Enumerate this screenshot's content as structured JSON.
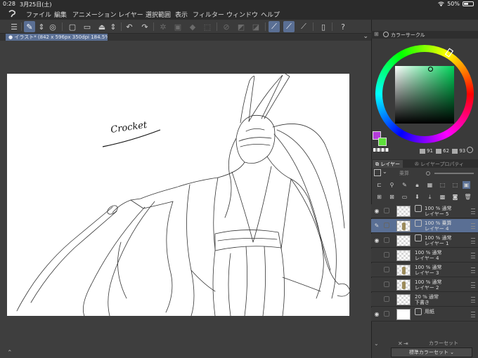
{
  "status": {
    "time": "0:28",
    "date": "3月25日(土)",
    "battery": "50%",
    "battery_level": 0.5
  },
  "menu": [
    "ファイル",
    "編集",
    "アニメーション",
    "レイヤー",
    "選択範囲",
    "表示",
    "フィルター",
    "ウィンドウ",
    "ヘルプ"
  ],
  "document": {
    "tab_label": "● イラスト* (842 x 596px 350dpi 184.5%)"
  },
  "canvas": {
    "signature": "Crocket"
  },
  "color_panel": {
    "title": "カラーサークル",
    "main_color": "#b33dd9",
    "sub_color": "#5de03a",
    "h": "91",
    "s": "62",
    "v": "93"
  },
  "layer_panel": {
    "tab_layer": "レイヤー",
    "tab_property": "レイヤープロパティ",
    "blend_label": "乗算",
    "layers": [
      {
        "line1": "100 % 通常",
        "line2": "レイヤー 5",
        "visible": true,
        "thumb": "checker",
        "mode_icon": true,
        "selected": false
      },
      {
        "line1": "100 % 乗算",
        "line2": "レイヤー 4",
        "visible": false,
        "thumb": "figure",
        "mode_icon": true,
        "selected": true
      },
      {
        "line1": "100 % 通常",
        "line2": "レイヤー 1",
        "visible": true,
        "thumb": "checker",
        "mode_icon": true,
        "selected": false
      },
      {
        "line1": "100 % 通常",
        "line2": "レイヤー 4",
        "visible": false,
        "thumb": "checker",
        "mode_icon": false,
        "selected": false
      },
      {
        "line1": "100 % 通常",
        "line2": "レイヤー 3",
        "visible": false,
        "thumb": "figure",
        "mode_icon": false,
        "selected": false
      },
      {
        "line1": "100 % 通常",
        "line2": "レイヤー 2",
        "visible": false,
        "thumb": "figure",
        "mode_icon": false,
        "selected": false
      },
      {
        "line1": "20 % 通常",
        "line2": "下書き",
        "visible": false,
        "thumb": "checker",
        "mode_icon": false,
        "selected": false
      },
      {
        "line1": "",
        "line2": "用紙",
        "visible": true,
        "thumb": "white",
        "mode_icon": true,
        "selected": false
      }
    ]
  },
  "color_set": {
    "title": "カラーセット",
    "button": "標準カラーセット"
  },
  "icons": {
    "logo": "clip-studio-logo-icon",
    "wifi": "wifi-icon",
    "battery": "battery-icon"
  }
}
